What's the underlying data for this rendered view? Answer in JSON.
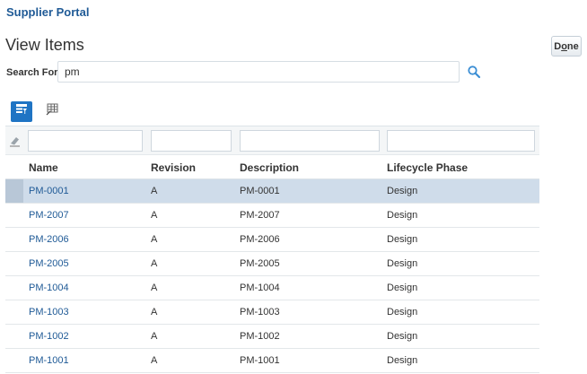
{
  "portal": {
    "title": "Supplier Portal"
  },
  "page": {
    "title": "View Items",
    "done_prefix": "D",
    "done_underlined": "o",
    "done_suffix": "ne"
  },
  "search": {
    "label": "Search For",
    "value": "pm"
  },
  "toolbar": {
    "filter_icon": "query-by-example-icon",
    "detach_icon": "detach-table-icon"
  },
  "table": {
    "columns": [
      "Name",
      "Revision",
      "Description",
      "Lifecycle Phase"
    ],
    "rows": [
      {
        "name": "PM-0001",
        "revision": "A",
        "description": "PM-0001",
        "lifecycle": "Design"
      },
      {
        "name": "PM-2007",
        "revision": "A",
        "description": "PM-2007",
        "lifecycle": "Design"
      },
      {
        "name": "PM-2006",
        "revision": "A",
        "description": "PM-2006",
        "lifecycle": "Design"
      },
      {
        "name": "PM-2005",
        "revision": "A",
        "description": "PM-2005",
        "lifecycle": "Design"
      },
      {
        "name": "PM-1004",
        "revision": "A",
        "description": "PM-1004",
        "lifecycle": "Design"
      },
      {
        "name": "PM-1003",
        "revision": "A",
        "description": "PM-1003",
        "lifecycle": "Design"
      },
      {
        "name": "PM-1002",
        "revision": "A",
        "description": "PM-1002",
        "lifecycle": "Design"
      },
      {
        "name": "PM-1001",
        "revision": "A",
        "description": "PM-1001",
        "lifecycle": "Design"
      }
    ]
  },
  "colors": {
    "brand": "#1f5a96",
    "selected_row": "#cfdcea",
    "tool_active": "#1f74c4"
  }
}
